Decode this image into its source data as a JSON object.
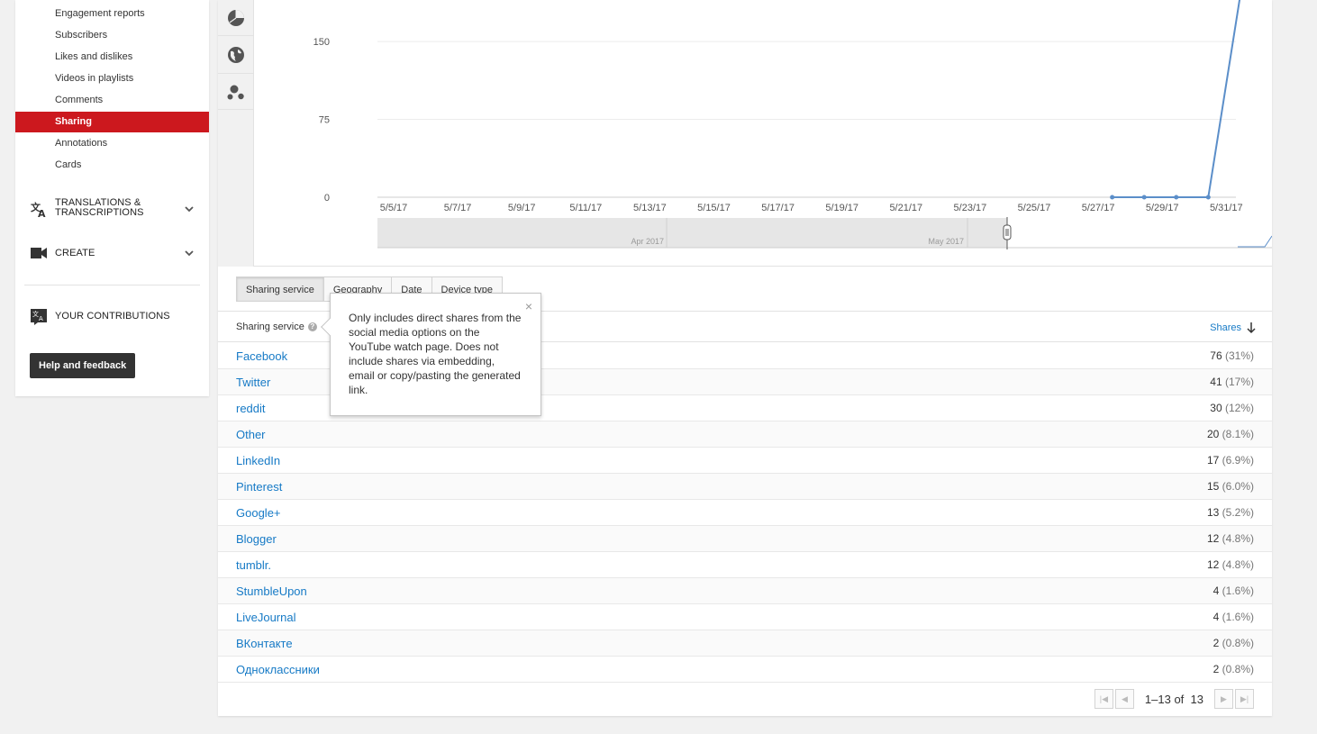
{
  "sidebar": {
    "items": [
      {
        "label": "Engagement reports",
        "active": false
      },
      {
        "label": "Subscribers",
        "active": false
      },
      {
        "label": "Likes and dislikes",
        "active": false
      },
      {
        "label": "Videos in playlists",
        "active": false
      },
      {
        "label": "Comments",
        "active": false
      },
      {
        "label": "Sharing",
        "active": true
      },
      {
        "label": "Annotations",
        "active": false
      },
      {
        "label": "Cards",
        "active": false
      }
    ],
    "translations": {
      "line1": "TRANSLATIONS &",
      "line2": "TRANSCRIPTIONS",
      "icon": "translate-icon"
    },
    "create": {
      "label": "CREATE",
      "icon": "video-camera-icon"
    },
    "contributions": {
      "label": "YOUR CONTRIBUTIONS",
      "icon": "translate-box-icon"
    },
    "help_label": "Help and feedback"
  },
  "chart_icons": [
    "pie-chart-icon",
    "globe-icon",
    "bubble-chart-icon"
  ],
  "chart_data": {
    "type": "line",
    "x": [
      "5/5/17",
      "5/6/17",
      "5/7/17",
      "5/8/17",
      "5/9/17",
      "5/10/17",
      "5/11/17",
      "5/12/17",
      "5/13/17",
      "5/14/17",
      "5/15/17",
      "5/16/17",
      "5/17/17",
      "5/18/17",
      "5/19/17",
      "5/20/17",
      "5/21/17",
      "5/22/17",
      "5/23/17",
      "5/24/17",
      "5/25/17",
      "5/26/17",
      "5/27/17",
      "5/28/17",
      "5/29/17",
      "5/30/17",
      "5/31/17",
      "6/1/17"
    ],
    "values": [
      null,
      null,
      null,
      null,
      null,
      null,
      null,
      null,
      null,
      null,
      null,
      null,
      null,
      null,
      null,
      null,
      null,
      null,
      null,
      null,
      null,
      null,
      null,
      0,
      0,
      0,
      0,
      225
    ],
    "x_tick_labels": [
      "5/5/17",
      "5/7/17",
      "5/9/17",
      "5/11/17",
      "5/13/17",
      "5/15/17",
      "5/17/17",
      "5/19/17",
      "5/21/17",
      "5/23/17",
      "5/25/17",
      "5/27/17",
      "5/29/17",
      "5/31/17"
    ],
    "y_ticks": [
      0,
      75,
      150
    ],
    "ylim": [
      0,
      190
    ],
    "line_color": "#5b8ec9",
    "grid": true,
    "range_labels": [
      "Apr 2017",
      "May 2017"
    ]
  },
  "tabs": [
    {
      "label": "Sharing service",
      "active": true
    },
    {
      "label": "Geography",
      "active": false
    },
    {
      "label": "Date",
      "active": false
    },
    {
      "label": "Device type",
      "active": false
    }
  ],
  "table": {
    "col_left": "Sharing service",
    "col_right": "Shares",
    "rows": [
      {
        "name": "Facebook",
        "count": "76",
        "pct": "(31%)"
      },
      {
        "name": "Twitter",
        "count": "41",
        "pct": "(17%)"
      },
      {
        "name": "reddit",
        "count": "30",
        "pct": "(12%)"
      },
      {
        "name": "Other",
        "count": "20",
        "pct": "(8.1%)"
      },
      {
        "name": "LinkedIn",
        "count": "17",
        "pct": "(6.9%)"
      },
      {
        "name": "Pinterest",
        "count": "15",
        "pct": "(6.0%)"
      },
      {
        "name": "Google+",
        "count": "13",
        "pct": "(5.2%)"
      },
      {
        "name": "Blogger",
        "count": "12",
        "pct": "(4.8%)"
      },
      {
        "name": "tumblr.",
        "count": "12",
        "pct": "(4.8%)"
      },
      {
        "name": "StumbleUpon",
        "count": "4",
        "pct": "(1.6%)"
      },
      {
        "name": "LiveJournal",
        "count": "4",
        "pct": "(1.6%)"
      },
      {
        "name": "ВКонтакте",
        "count": "2",
        "pct": "(0.8%)"
      },
      {
        "name": "Одноклассники",
        "count": "2",
        "pct": "(0.8%)"
      }
    ]
  },
  "pager": {
    "range": "1–13 of",
    "total": "13"
  },
  "tooltip": {
    "text": "Only includes direct shares from the social media options on the YouTube watch page. Does not include shares via embedding, email or copy/pasting the generated link.",
    "close": "×"
  }
}
